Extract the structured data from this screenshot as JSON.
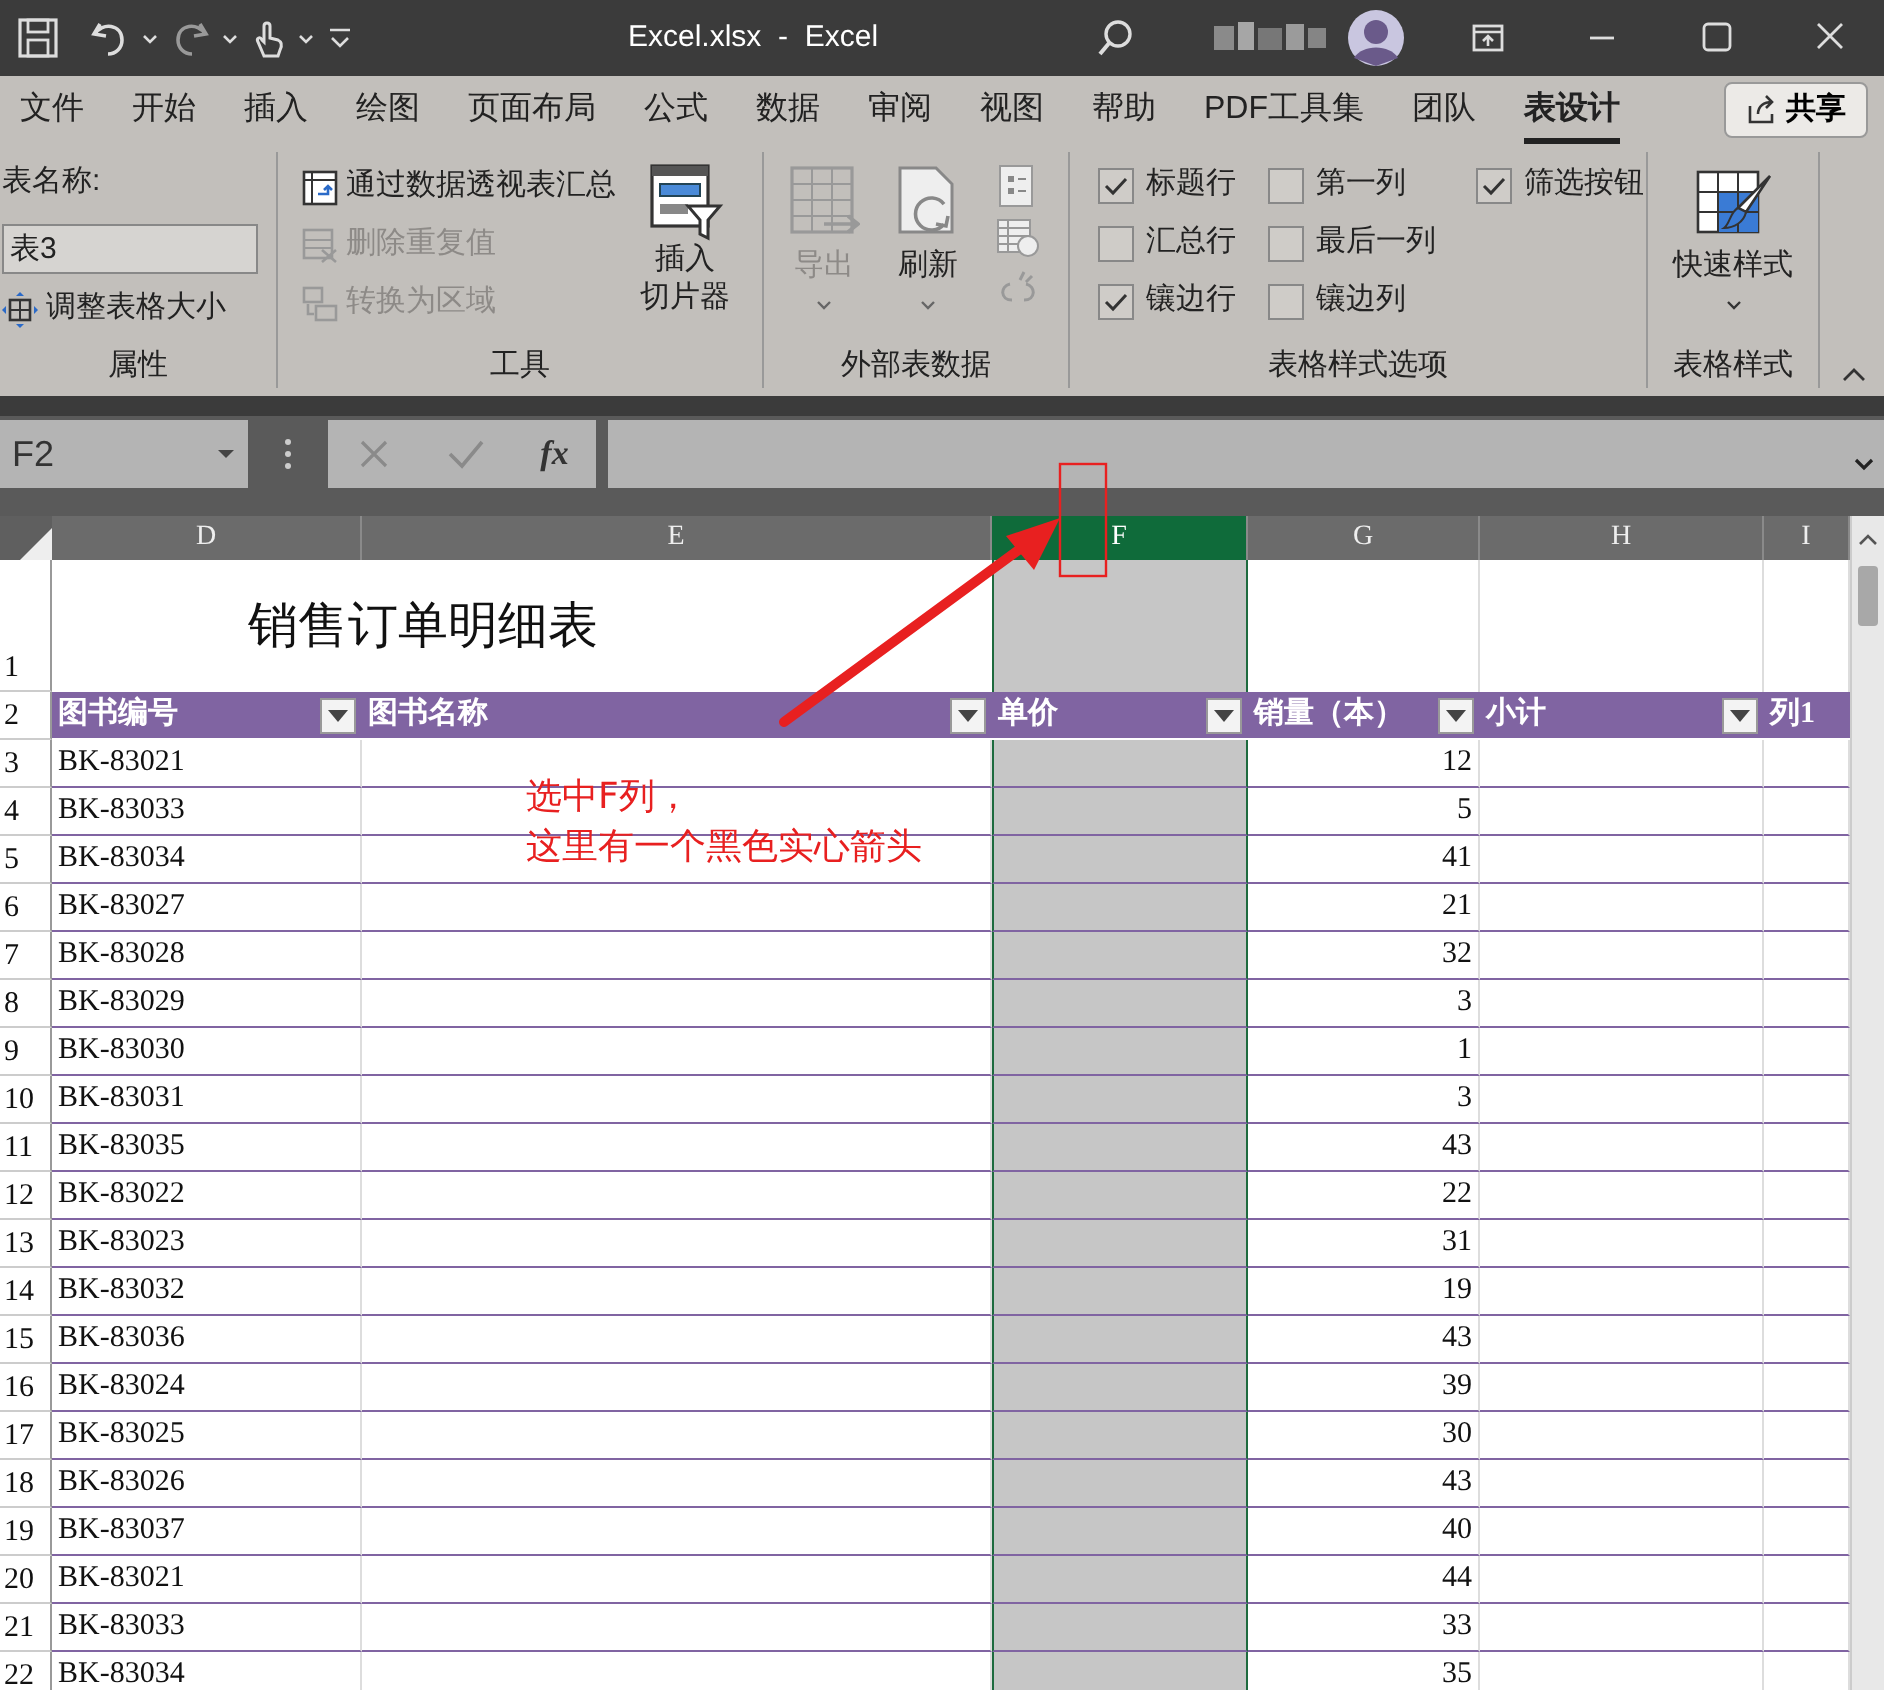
{
  "title_bar": {
    "title": "Excel.xlsx  -  Excel"
  },
  "ribbon_tabs": [
    {
      "label": "文件",
      "selected": false
    },
    {
      "label": "开始",
      "selected": false
    },
    {
      "label": "插入",
      "selected": false
    },
    {
      "label": "绘图",
      "selected": false
    },
    {
      "label": "页面布局",
      "selected": false
    },
    {
      "label": "公式",
      "selected": false
    },
    {
      "label": "数据",
      "selected": false
    },
    {
      "label": "审阅",
      "selected": false
    },
    {
      "label": "视图",
      "selected": false
    },
    {
      "label": "帮助",
      "selected": false
    },
    {
      "label": "PDF工具集",
      "selected": false
    },
    {
      "label": "团队",
      "selected": false
    },
    {
      "label": "表设计",
      "selected": true
    }
  ],
  "share_button": "共享",
  "properties_group": {
    "label": "属性",
    "table_name_label": "表名称:",
    "table_name": "表3",
    "resize_button": "调整表格大小"
  },
  "tools_group": {
    "label": "工具",
    "buttons": [
      {
        "label": "通过数据透视表汇总",
        "disabled": false
      },
      {
        "label": "删除重复值",
        "disabled": true
      },
      {
        "label": "转换为区域",
        "disabled": true
      }
    ],
    "slicer_button": [
      "插入",
      "切片器"
    ]
  },
  "external_group": {
    "label": "外部表数据",
    "buttons": [
      {
        "label": "导出",
        "disabled": true
      },
      {
        "label": "刷新",
        "disabled": false
      }
    ]
  },
  "style_options_group": {
    "label": "表格样式选项",
    "options": [
      {
        "label": "标题行",
        "checked": true
      },
      {
        "label": "汇总行",
        "checked": false
      },
      {
        "label": "镶边行",
        "checked": true
      },
      {
        "label": "第一列",
        "checked": false
      },
      {
        "label": "最后一列",
        "checked": false
      },
      {
        "label": "镶边列",
        "checked": false
      },
      {
        "label": "筛选按钮",
        "checked": true
      }
    ]
  },
  "styles_group": {
    "label": "表格样式",
    "quick_styles_button": "快速样式"
  },
  "formula_bar": {
    "name_box": "F2",
    "function_button": "fx"
  },
  "sheet": {
    "columns": [
      {
        "label": "D",
        "selected": false
      },
      {
        "label": "E",
        "selected": false
      },
      {
        "label": "F",
        "selected": true
      },
      {
        "label": "G",
        "selected": false
      },
      {
        "label": "H",
        "selected": false
      },
      {
        "label": "I",
        "selected": false
      }
    ],
    "title_row": "1",
    "title": "销售订单明细表",
    "header_row": "2",
    "headers": [
      "图书编号",
      "图书名称",
      "单价",
      "销量（本）",
      "小计",
      "列1"
    ],
    "rows": [
      {
        "row": "3",
        "id": "BK-83021",
        "qty": "12"
      },
      {
        "row": "4",
        "id": "BK-83033",
        "qty": "5"
      },
      {
        "row": "5",
        "id": "BK-83034",
        "qty": "41"
      },
      {
        "row": "6",
        "id": "BK-83027",
        "qty": "21"
      },
      {
        "row": "7",
        "id": "BK-83028",
        "qty": "32"
      },
      {
        "row": "8",
        "id": "BK-83029",
        "qty": "3"
      },
      {
        "row": "9",
        "id": "BK-83030",
        "qty": "1"
      },
      {
        "row": "10",
        "id": "BK-83031",
        "qty": "3"
      },
      {
        "row": "11",
        "id": "BK-83035",
        "qty": "43"
      },
      {
        "row": "12",
        "id": "BK-83022",
        "qty": "22"
      },
      {
        "row": "13",
        "id": "BK-83023",
        "qty": "31"
      },
      {
        "row": "14",
        "id": "BK-83032",
        "qty": "19"
      },
      {
        "row": "15",
        "id": "BK-83036",
        "qty": "43"
      },
      {
        "row": "16",
        "id": "BK-83024",
        "qty": "39"
      },
      {
        "row": "17",
        "id": "BK-83025",
        "qty": "30"
      },
      {
        "row": "18",
        "id": "BK-83026",
        "qty": "43"
      },
      {
        "row": "19",
        "id": "BK-83037",
        "qty": "40"
      },
      {
        "row": "20",
        "id": "BK-83021",
        "qty": "44"
      },
      {
        "row": "21",
        "id": "BK-83033",
        "qty": "33"
      },
      {
        "row": "22",
        "id": "BK-83034",
        "qty": "35"
      }
    ]
  },
  "annotation": {
    "lines": [
      "选中F列，",
      "这里有一个黑色实心箭头"
    ]
  }
}
